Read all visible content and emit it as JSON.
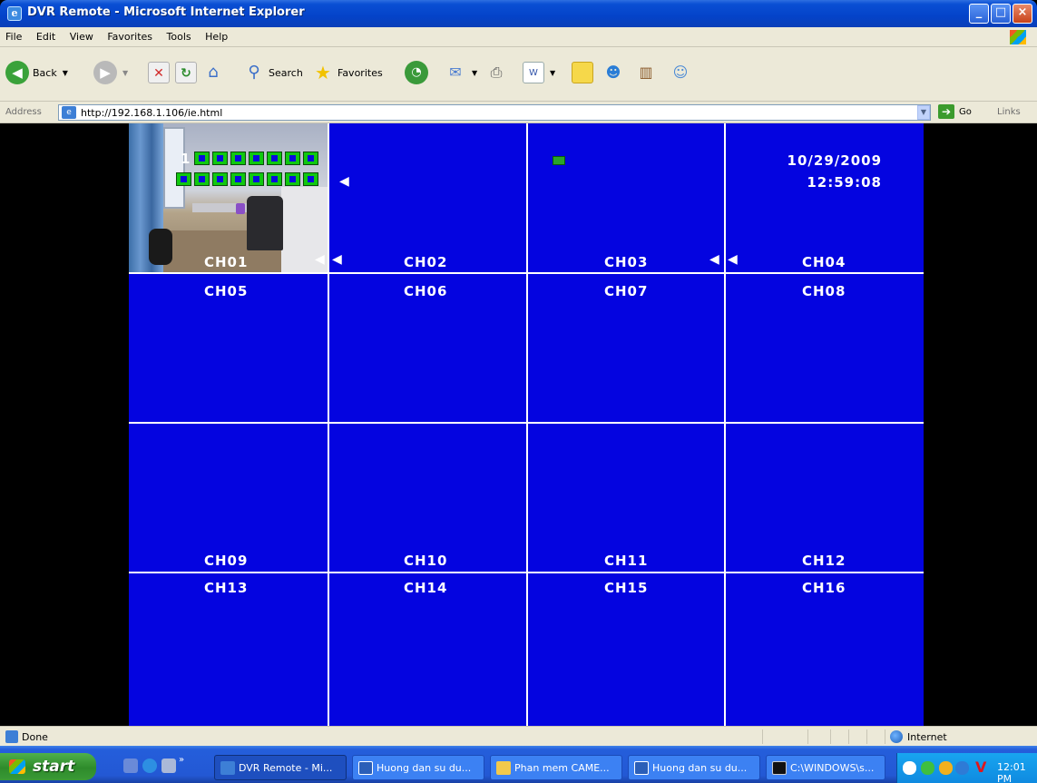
{
  "window": {
    "title": "DVR Remote - Microsoft Internet Explorer",
    "minimize": "_",
    "maximize": "□",
    "close": "×"
  },
  "menu": [
    "File",
    "Edit",
    "View",
    "Favorites",
    "Tools",
    "Help"
  ],
  "toolbar": {
    "back_label": "Back",
    "search_label": "Search",
    "favorites_label": "Favorites"
  },
  "address": {
    "label": "Address",
    "url": "http://192.168.1.106/ie.html",
    "go_label": "Go",
    "links_label": "Links"
  },
  "dvr": {
    "date": "10/29/2009",
    "time": "12:59:08",
    "motion_channel": "1",
    "channels": [
      "CH01",
      "CH02",
      "CH03",
      "CH04",
      "CH05",
      "CH06",
      "CH07",
      "CH08",
      "CH09",
      "CH10",
      "CH11",
      "CH12",
      "CH13",
      "CH14",
      "CH15",
      "CH16"
    ]
  },
  "status": {
    "text": "Done",
    "zone": "Internet"
  },
  "taskbar": {
    "start_label": "start",
    "tasks": [
      "DVR Remote - Mi...",
      "Huong dan su du...",
      "Phan mem CAME...",
      "Huong dan su du...",
      "C:\\WINDOWS\\s..."
    ],
    "clock": "12:01 PM"
  },
  "colors": {
    "dvr_background": "#0404e0",
    "grid_lines": "#ffffff",
    "title_bar": "#0443c9",
    "chrome": "#ece9d8"
  }
}
